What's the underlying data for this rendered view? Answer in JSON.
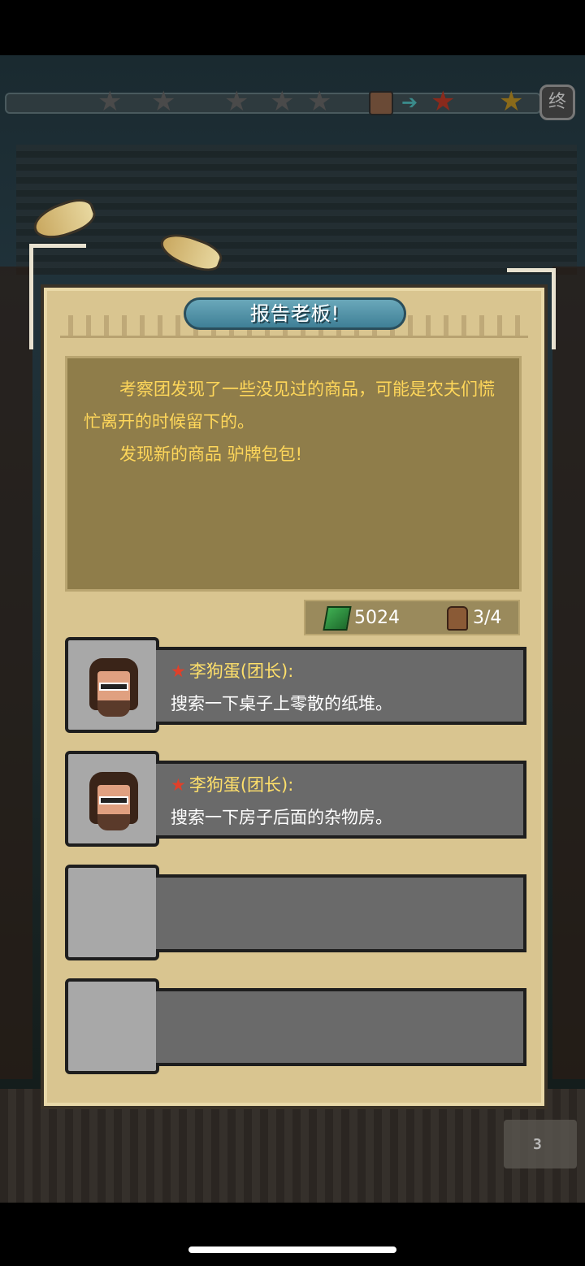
{
  "topbar": {
    "stars": [
      "empty",
      "empty",
      "empty",
      "empty",
      "empty"
    ],
    "next_stars": [
      "red",
      "gold"
    ],
    "end_badge": "终"
  },
  "dialog": {
    "title": "报告老板!",
    "message_lines": [
      "考察团发现了一些没见过的商品，可能是农夫们慌忙离开的时候留下的。",
      "发现新的商品 驴牌包包!"
    ]
  },
  "stats": {
    "money": "5024",
    "capacity": "3/4",
    "money_icon": "cash-icon",
    "bag_icon": "backpack-icon"
  },
  "members": [
    {
      "name": "李狗蛋(团长):",
      "action": "搜索一下桌子上零散的纸堆。"
    },
    {
      "name": "李狗蛋(团长):",
      "action": "搜索一下房子后面的杂物房。"
    }
  ],
  "empty_slots": 2,
  "footer": {
    "book_count": "3"
  },
  "colors": {
    "panel": "#d9c590",
    "message_text": "#ffd75a",
    "title_pill": "#4f8fa6",
    "member_name": "#ffe06a",
    "rank_star": "#e0402a"
  }
}
